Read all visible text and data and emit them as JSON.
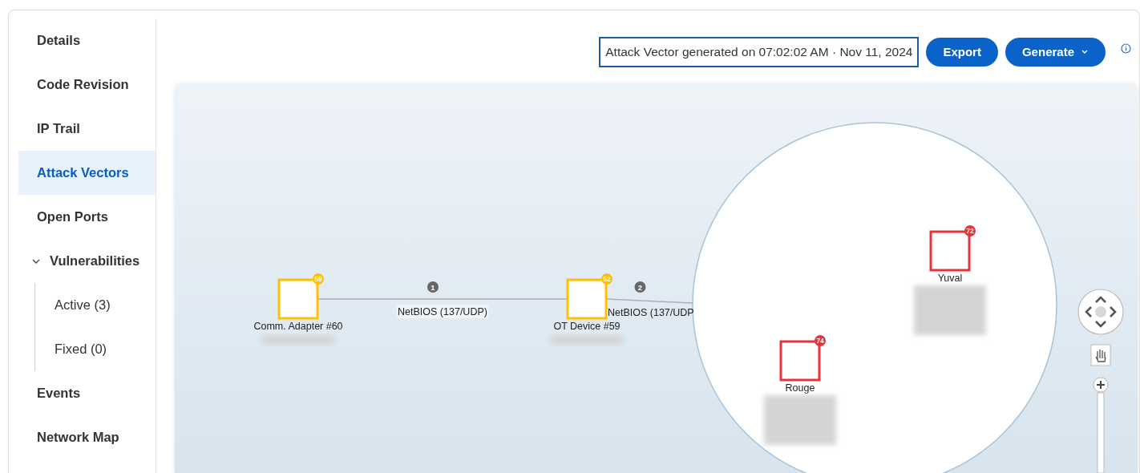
{
  "sidebar": {
    "items": [
      {
        "label": "Details",
        "selected": false
      },
      {
        "label": "Code Revision",
        "selected": false
      },
      {
        "label": "IP Trail",
        "selected": false
      },
      {
        "label": "Attack Vectors",
        "selected": true
      },
      {
        "label": "Open Ports",
        "selected": false
      },
      {
        "label": "Vulnerabilities",
        "selected": false,
        "expanded": true,
        "children": [
          {
            "label": "Active (3)",
            "selected": false
          },
          {
            "label": "Fixed (0)",
            "selected": false
          }
        ]
      },
      {
        "label": "Events",
        "selected": false
      },
      {
        "label": "Network Map",
        "selected": false
      }
    ]
  },
  "toolbar": {
    "generated_text": "Attack Vector generated on 07:02:02 AM · Nov 11, 2024",
    "export_button": "Export",
    "generate_button": "Generate"
  },
  "graph": {
    "nodes": [
      {
        "label": "Comm. Adapter #60",
        "badge": "59",
        "color": "#ffc000"
      },
      {
        "label": "OT Device #59",
        "badge": "52",
        "color": "#ffc000"
      },
      {
        "label": "Yuval",
        "badge": "72",
        "color": "#e8333c"
      },
      {
        "label": "Rouge",
        "badge": "74",
        "color": "#e8333c"
      }
    ],
    "edges": [
      {
        "number": "1",
        "label": "NetBIOS (137/UDP)"
      },
      {
        "number": "2",
        "label": "NetBIOS (137/UDP"
      }
    ]
  }
}
